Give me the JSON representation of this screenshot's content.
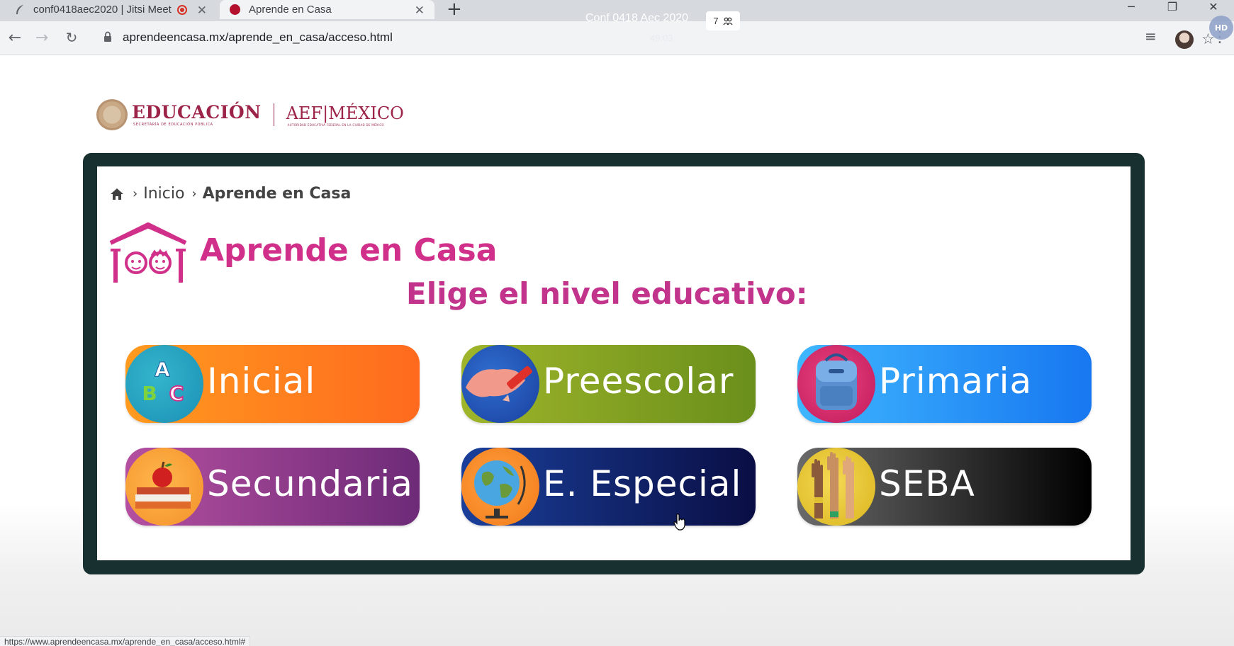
{
  "browser": {
    "tabs": [
      {
        "title": "conf0418aec2020 | Jitsi Meet",
        "close": "✕"
      },
      {
        "title": "Aprende en Casa",
        "close": "✕"
      }
    ],
    "new_tab": "+",
    "url": "aprendeencasa.mx/aprende_en_casa/acceso.html",
    "status_url": "https://www.aprendeencasa.mx/aprende_en_casa/acceso.html#",
    "window_controls": {
      "minimize": "─",
      "restore": "❐",
      "close": "✕"
    }
  },
  "meeting": {
    "title": "Conf 0418 Aec 2020",
    "timer": "49:03",
    "participants": "7",
    "quality_badge": "HD"
  },
  "header": {
    "logo_main": "EDUCACIÓN",
    "logo_main_sub": "SECRETARÍA DE EDUCACIÓN PÚBLICA",
    "logo_second": "AEF|MÉXICO",
    "logo_second_sub": "AUTORIDAD EDUCATIVA FEDERAL EN LA CIUDAD DE MÉXICO"
  },
  "breadcrumb": {
    "items": [
      "Inicio",
      "Aprende en Casa"
    ]
  },
  "main": {
    "title": "Aprende en Casa",
    "subtitle": "Elige el nivel educativo:",
    "levels": [
      {
        "label": "Inicial",
        "icon": "abc-blocks-icon",
        "color": "#ff7a1f"
      },
      {
        "label": "Preescolar",
        "icon": "crayon-icon",
        "color": "#8aa624"
      },
      {
        "label": "Primaria",
        "icon": "backpack-icon",
        "color": "#2a96f7"
      },
      {
        "label": "Secundaria",
        "icon": "apple-books-icon",
        "color": "#8e3a8c"
      },
      {
        "label": "E. Especial",
        "icon": "globe-icon",
        "color": "#112a78"
      },
      {
        "label": "SEBA",
        "icon": "raised-hands-icon",
        "color": "#333333"
      }
    ]
  },
  "colors": {
    "brand": "#9d2449",
    "title_pink": "#d1308a",
    "frame": "#183130"
  }
}
